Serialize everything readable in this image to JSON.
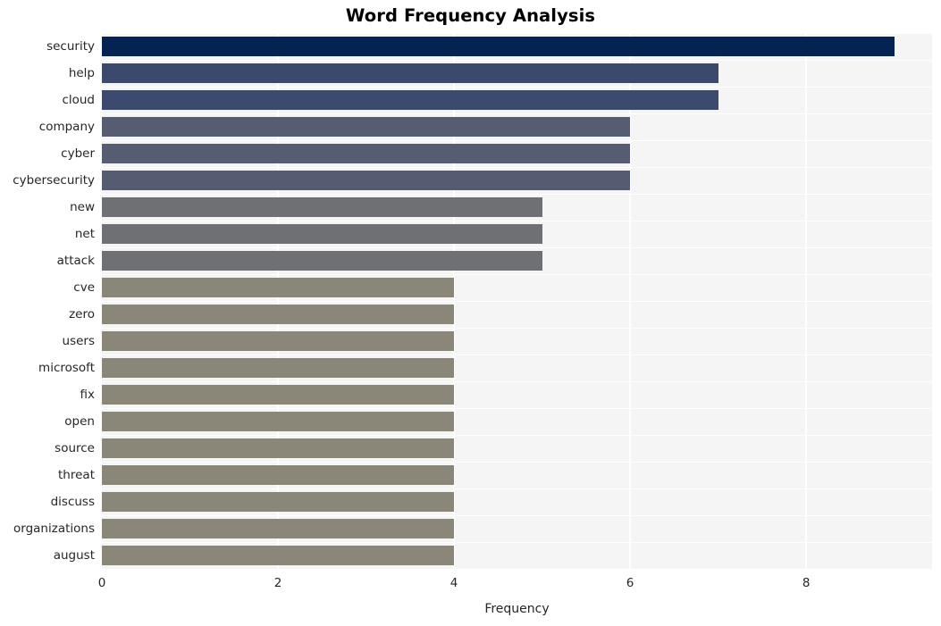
{
  "chart_data": {
    "type": "bar",
    "orientation": "horizontal",
    "title": "Word Frequency Analysis",
    "xlabel": "Frequency",
    "ylabel": "",
    "xlim": [
      0,
      9.43
    ],
    "xticks": [
      0,
      2,
      4,
      6,
      8
    ],
    "xticklabels": [
      "0",
      "2",
      "4",
      "6",
      "8"
    ],
    "grid": true,
    "grid_color": "#ffffff",
    "plot_background": "#f5f5f6",
    "figure_background": "#ffffff",
    "legend": "none",
    "categories": [
      "security",
      "help",
      "cloud",
      "company",
      "cyber",
      "cybersecurity",
      "new",
      "net",
      "attack",
      "cve",
      "zero",
      "users",
      "microsoft",
      "fix",
      "open",
      "source",
      "threat",
      "discuss",
      "organizations",
      "august"
    ],
    "values": [
      9,
      7,
      7,
      6,
      6,
      6,
      5,
      5,
      5,
      4,
      4,
      4,
      4,
      4,
      4,
      4,
      4,
      4,
      4,
      4
    ],
    "bar_colors": [
      "#042352",
      "#3c496e",
      "#3d4a70",
      "#565c72",
      "#565c72",
      "#555b71",
      "#6e7074",
      "#6e7074",
      "#6e7073",
      "#8a8778",
      "#8a8778",
      "#8a8778",
      "#8a8778",
      "#8a8778",
      "#8a8778",
      "#8a8778",
      "#8a8778",
      "#8a8778",
      "#8a8778",
      "#8a8778"
    ]
  }
}
